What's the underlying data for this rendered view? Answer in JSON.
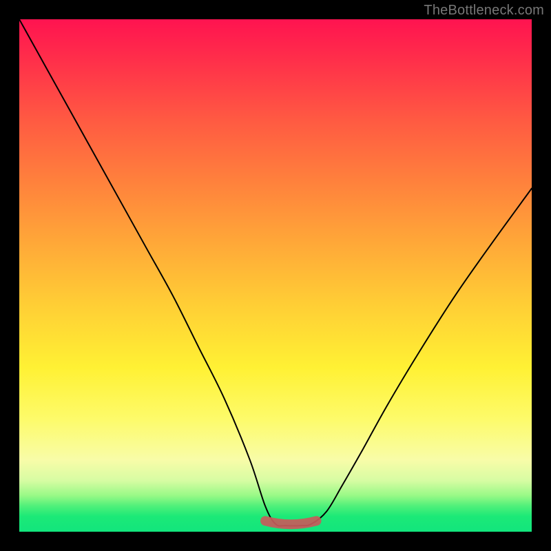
{
  "watermark": "TheBottleneck.com",
  "colors": {
    "background": "#000000",
    "curve": "#000000",
    "valley_highlight": "#c75b5b",
    "gradient_top": "#ff1350",
    "gradient_bottom": "#12e57d"
  },
  "chart_data": {
    "type": "line",
    "title": "",
    "xlabel": "",
    "ylabel": "",
    "xlim": [
      0,
      100
    ],
    "ylim": [
      0,
      100
    ],
    "grid": false,
    "legend": false,
    "series": [
      {
        "name": "bottleneck-curve",
        "x": [
          0,
          5,
          10,
          15,
          20,
          25,
          30,
          35,
          40,
          45,
          48,
          50,
          52,
          55,
          57,
          60,
          63,
          67,
          72,
          78,
          85,
          92,
          100
        ],
        "y": [
          100,
          91,
          82,
          73,
          64,
          55,
          46,
          36,
          26,
          14,
          5,
          1.5,
          1.2,
          1.2,
          1.5,
          4,
          9,
          16,
          25,
          35,
          46,
          56,
          67
        ]
      }
    ],
    "highlight": {
      "name": "optimal-range",
      "x_range": [
        48,
        58
      ],
      "y": 1.3
    },
    "background_gradient": {
      "orientation": "vertical",
      "stops": [
        {
          "pos": 0.0,
          "color": "#ff1350"
        },
        {
          "pos": 0.2,
          "color": "#ff5b42"
        },
        {
          "pos": 0.44,
          "color": "#ffa938"
        },
        {
          "pos": 0.68,
          "color": "#fff134"
        },
        {
          "pos": 0.86,
          "color": "#f8fca8"
        },
        {
          "pos": 0.95,
          "color": "#4ff07a"
        },
        {
          "pos": 1.0,
          "color": "#12e57d"
        }
      ]
    }
  }
}
